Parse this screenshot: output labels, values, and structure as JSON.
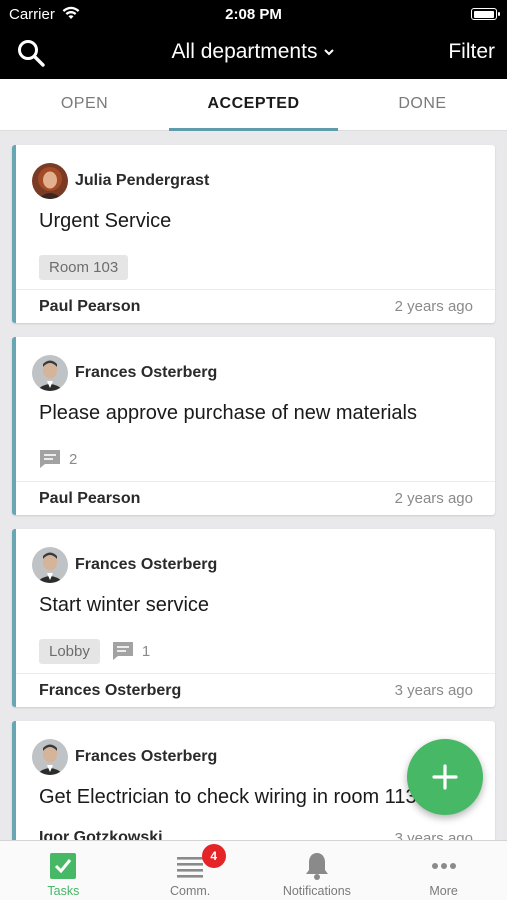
{
  "status_bar": {
    "carrier": "Carrier",
    "time": "2:08 PM",
    "battery_level": 1.0
  },
  "nav": {
    "title": "All departments",
    "filter_label": "Filter"
  },
  "tabs": [
    {
      "label": "OPEN",
      "active": false
    },
    {
      "label": "ACCEPTED",
      "active": true
    },
    {
      "label": "DONE",
      "active": false
    }
  ],
  "tasks": [
    {
      "author": "Julia Pendergrast",
      "title": "Urgent Service",
      "location": "Room 103",
      "comments": "",
      "assignee": "Paul Pearson",
      "age": "2 years ago"
    },
    {
      "author": "Frances Osterberg",
      "title": "Please approve purchase of new materials",
      "location": "",
      "comments": "2",
      "assignee": "Paul Pearson",
      "age": "2 years ago"
    },
    {
      "author": "Frances Osterberg",
      "title": "Start winter service",
      "location": "Lobby",
      "comments": "1",
      "assignee": "Frances Osterberg",
      "age": "3 years ago"
    },
    {
      "author": "Frances Osterberg",
      "title": "Get Electrician to check wiring in room 113",
      "location": "",
      "comments": "",
      "assignee": "Igor Gotzkowski",
      "age": "3 years ago"
    }
  ],
  "bottom_nav": [
    {
      "label": "Tasks",
      "icon": "checkbox-icon",
      "active": true
    },
    {
      "label": "Comm.",
      "icon": "list-icon",
      "badge": "4"
    },
    {
      "label": "Notifications",
      "icon": "bell-icon"
    },
    {
      "label": "More",
      "icon": "ellipsis-icon"
    }
  ],
  "colors": {
    "accent": "#5f9cab",
    "fab": "#47b865",
    "badge": "#e42426",
    "card_border": "#6aa5b3"
  }
}
